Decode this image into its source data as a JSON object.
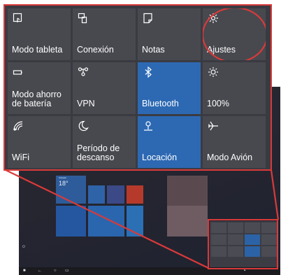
{
  "action_center": {
    "tiles": [
      {
        "label": "Modo tableta",
        "icon": "tablet-mode-icon",
        "active": false
      },
      {
        "label": "Conexión",
        "icon": "connect-icon",
        "active": false
      },
      {
        "label": "Notas",
        "icon": "note-icon",
        "active": false
      },
      {
        "label": "Ajustes",
        "icon": "gear-icon",
        "active": false
      },
      {
        "label": "Modo ahorro de batería",
        "icon": "battery-saver-icon",
        "active": false
      },
      {
        "label": "VPN",
        "icon": "vpn-icon",
        "active": false
      },
      {
        "label": "Bluetooth",
        "icon": "bluetooth-icon",
        "active": true
      },
      {
        "label": "100%",
        "icon": "brightness-icon",
        "active": false
      },
      {
        "label": "WiFi",
        "icon": "wifi-icon",
        "active": false
      },
      {
        "label": "Período de descanso",
        "icon": "moon-icon",
        "active": false
      },
      {
        "label": "Locación",
        "icon": "location-icon",
        "active": true
      },
      {
        "label": "Modo Avión",
        "icon": "airplane-icon",
        "active": false
      }
    ]
  },
  "colors": {
    "panel_bg": "#3a3b42",
    "tile_bg": "#48494f",
    "tile_active": "#2d69b3",
    "highlight": "#d93a3a"
  }
}
